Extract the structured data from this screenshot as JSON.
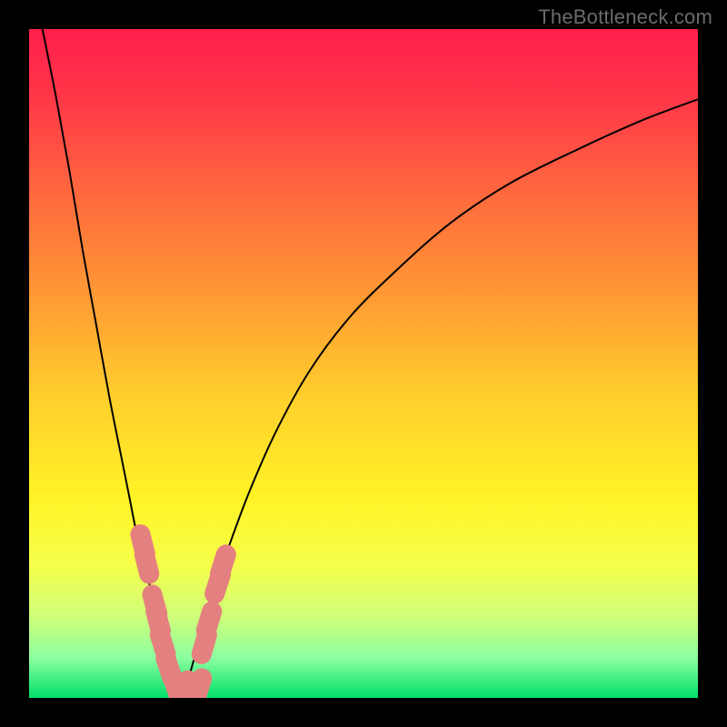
{
  "watermark": "TheBottleneck.com",
  "gradient": {
    "stops": [
      {
        "offset": 0.0,
        "color": "#ff1f4b"
      },
      {
        "offset": 0.1,
        "color": "#ff3648"
      },
      {
        "offset": 0.25,
        "color": "#ff6a3e"
      },
      {
        "offset": 0.4,
        "color": "#ff9a34"
      },
      {
        "offset": 0.55,
        "color": "#ffcf2c"
      },
      {
        "offset": 0.7,
        "color": "#fff326"
      },
      {
        "offset": 0.8,
        "color": "#f6ff4a"
      },
      {
        "offset": 0.88,
        "color": "#ceff7a"
      },
      {
        "offset": 0.94,
        "color": "#8cffa0"
      },
      {
        "offset": 1.0,
        "color": "#02e06a"
      }
    ]
  },
  "chart_data": {
    "type": "line",
    "title": "",
    "xlabel": "",
    "ylabel": "",
    "xlim": [
      0,
      100
    ],
    "ylim": [
      0,
      100
    ],
    "grid": false,
    "legend": false,
    "series": [
      {
        "name": "left-curve",
        "x": [
          2,
          4,
          6,
          8,
          10,
          12,
          14,
          15,
          16,
          17,
          18,
          19,
          20,
          21,
          22,
          23
        ],
        "y": [
          100,
          90,
          79,
          67,
          56,
          45,
          35,
          30,
          25,
          21,
          17,
          13,
          9.5,
          6.5,
          3.5,
          0.5
        ]
      },
      {
        "name": "right-curve",
        "x": [
          23,
          24,
          25,
          26,
          28,
          30,
          33,
          37,
          42,
          48,
          55,
          63,
          72,
          82,
          92,
          100
        ],
        "y": [
          0.5,
          3.5,
          7,
          10.5,
          17,
          23,
          31,
          40,
          49,
          57,
          64,
          71,
          77,
          82,
          86.5,
          89.5
        ]
      }
    ],
    "markers": [
      {
        "x": 17.0,
        "y": 23.0
      },
      {
        "x": 17.6,
        "y": 20.0
      },
      {
        "x": 18.8,
        "y": 14.0
      },
      {
        "x": 19.3,
        "y": 11.5
      },
      {
        "x": 20.0,
        "y": 8.0
      },
      {
        "x": 20.9,
        "y": 4.5
      },
      {
        "x": 22.0,
        "y": 1.5
      },
      {
        "x": 23.0,
        "y": 0.8
      },
      {
        "x": 24.2,
        "y": 1.2
      },
      {
        "x": 25.4,
        "y": 1.5
      },
      {
        "x": 26.2,
        "y": 8.0
      },
      {
        "x": 26.9,
        "y": 11.5
      },
      {
        "x": 28.2,
        "y": 17.0
      },
      {
        "x": 29.0,
        "y": 20.0
      }
    ],
    "marker_style": {
      "color": "#e58080",
      "radius_percent": 1.5,
      "length_percent": 3.0
    }
  }
}
